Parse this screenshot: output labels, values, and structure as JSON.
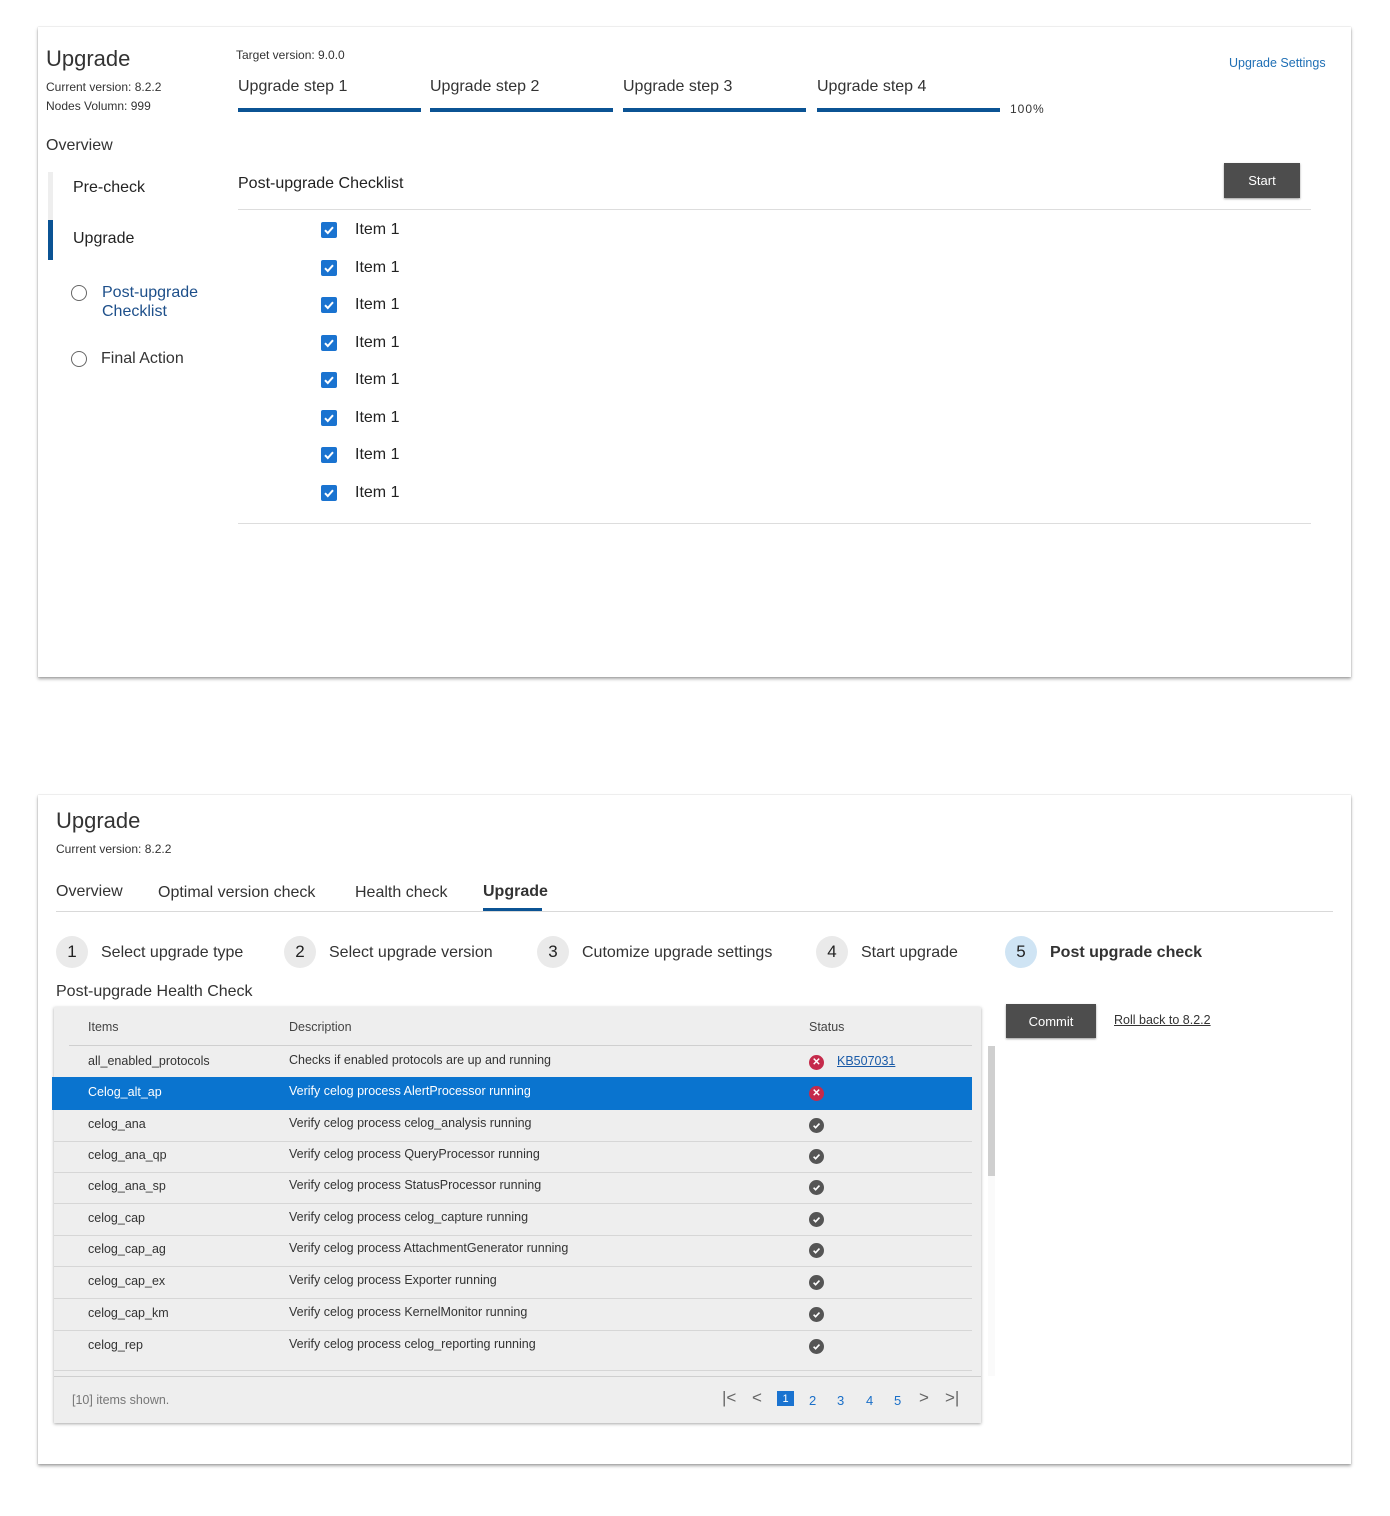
{
  "card1": {
    "title": "Upgrade",
    "current_version": "Current version: 8.2.2",
    "nodes": "Nodes Volumn: 999",
    "target_version": "Target version: 9.0.0",
    "settings_link": "Upgrade Settings",
    "progress_label": "100%",
    "progress_fraction": 1.0,
    "steps": [
      "Upgrade step 1",
      "Upgrade step 2",
      "Upgrade step 3",
      "Upgrade step 4"
    ],
    "nav": {
      "heading": "Overview",
      "precheck": "Pre-check",
      "upgrade": "Upgrade",
      "post_upgrade": "Post-upgrade Checklist",
      "final_action": "Final Action"
    },
    "checklist_title": "Post-upgrade Checklist",
    "start_label": "Start",
    "items": [
      "Item 1",
      "Item 1",
      "Item 1",
      "Item 1",
      "Item 1",
      "Item 1",
      "Item 1",
      "Item 1"
    ]
  },
  "card2": {
    "title": "Upgrade",
    "current_version": "Current version: 8.2.2",
    "tabs": [
      "Overview",
      "Optimal version check",
      "Health check",
      "Upgrade"
    ],
    "active_tab": "Upgrade",
    "steps": [
      {
        "num": "1",
        "label": "Select upgrade type"
      },
      {
        "num": "2",
        "label": "Select upgrade version"
      },
      {
        "num": "3",
        "label": "Cutomize upgrade settings"
      },
      {
        "num": "4",
        "label": "Start upgrade"
      },
      {
        "num": "5",
        "label": "Post upgrade check"
      }
    ],
    "section_title": "Post-upgrade Health Check",
    "columns": [
      "Items",
      "Description",
      "Status"
    ],
    "rows": [
      {
        "item": "all_enabled_protocols",
        "desc": "Checks if enabled protocols are up and running",
        "status": "error",
        "link": "KB507031"
      },
      {
        "item": "Celog_alt_ap",
        "desc": "Verify celog process AlertProcessor running",
        "status": "error",
        "link": ""
      },
      {
        "item": "celog_ana",
        "desc": "Verify celog process celog_analysis running",
        "status": "ok",
        "link": ""
      },
      {
        "item": "celog_ana_qp",
        "desc": "Verify celog process QueryProcessor running",
        "status": "ok",
        "link": ""
      },
      {
        "item": "celog_ana_sp",
        "desc": "Verify celog process StatusProcessor running",
        "status": "ok",
        "link": ""
      },
      {
        "item": "celog_cap",
        "desc": "Verify celog process celog_capture running",
        "status": "ok",
        "link": ""
      },
      {
        "item": "celog_cap_ag",
        "desc": "Verify celog process AttachmentGenerator running",
        "status": "ok",
        "link": ""
      },
      {
        "item": "celog_cap_ex",
        "desc": "Verify celog process Exporter running",
        "status": "ok",
        "link": ""
      },
      {
        "item": "celog_cap_km",
        "desc": "Verify celog process KernelMonitor running",
        "status": "ok",
        "link": ""
      },
      {
        "item": "celog_rep",
        "desc": "Verify celog process celog_reporting running",
        "status": "ok",
        "link": ""
      }
    ],
    "footer_text": "[10] items shown.",
    "pages": [
      "1",
      "2",
      "3",
      "4",
      "5"
    ],
    "current_page": "1",
    "commit_label": "Commit",
    "rollback_label": "Roll back to 8.2.2"
  }
}
